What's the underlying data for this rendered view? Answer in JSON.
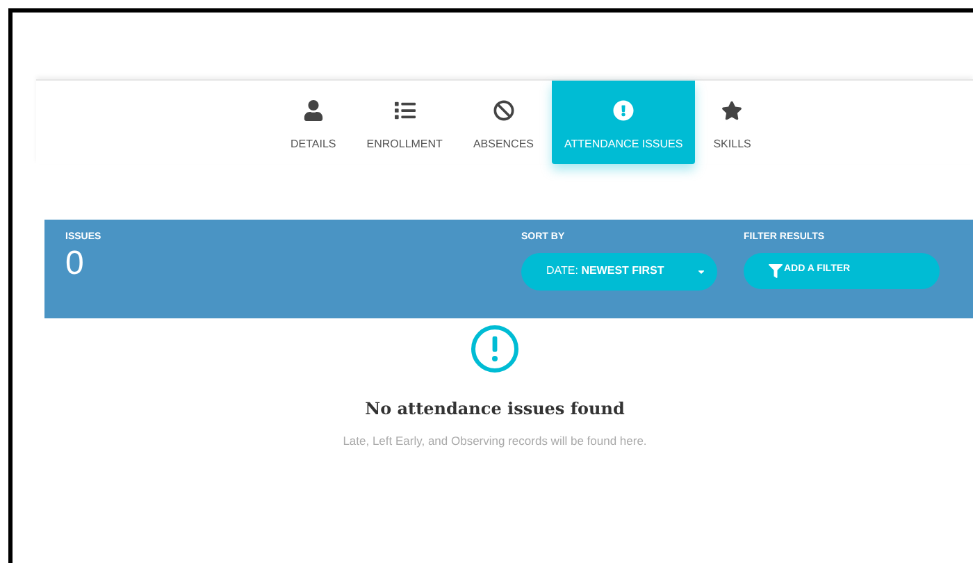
{
  "tabs": [
    {
      "label": "DETAILS",
      "selected": false
    },
    {
      "label": "ENROLLMENT",
      "selected": false
    },
    {
      "label": "ABSENCES",
      "selected": false
    },
    {
      "label": "ATTENDANCE ISSUES",
      "selected": true
    },
    {
      "label": "SKILLS",
      "selected": false
    }
  ],
  "summary": {
    "issues_label": "ISSUES",
    "issues_count": "0",
    "sort_label": "SORT BY",
    "sort_value": "DATE: **NEWEST FIRST**",
    "filter_label": "FILTER RESULTS",
    "filter_button": "ADD A FILTER"
  },
  "empty_state": {
    "title": "No attendance issues found",
    "message": "Late, Left Early, and Observing records will be found here."
  }
}
